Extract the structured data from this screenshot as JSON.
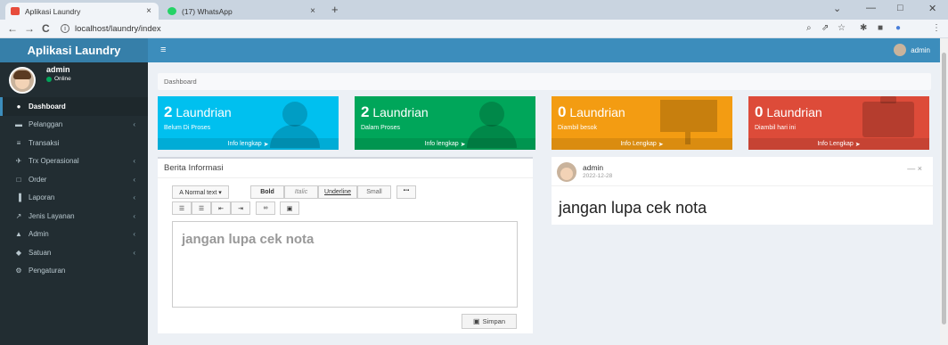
{
  "browser": {
    "tabs": [
      {
        "title": "Aplikasi Laundry",
        "close": "×"
      },
      {
        "title": "(17) WhatsApp",
        "close": "×"
      }
    ],
    "new_tab": "+",
    "url": "localhost/laundry/index",
    "info_glyph": "i",
    "back_glyph": "←",
    "forward_glyph": "→",
    "reload_glyph": "C",
    "window_controls": {
      "chevron": "⌄",
      "minimize": "—",
      "maximize": "□",
      "close": "✕"
    },
    "ext_icons": [
      "zoom-icon",
      "share-icon",
      "star-icon",
      "puzzle-icon",
      "sidepanel-icon",
      "profile-icon",
      "kebab-icon"
    ],
    "ext_glyphs": [
      "⌕",
      "⇗",
      "☆",
      "✱",
      "■",
      "●",
      "⋮"
    ],
    "favicon_colors": {
      "laundry": "#e74c3c",
      "whatsapp": "#25d366"
    }
  },
  "app": {
    "brand": "Aplikasi Laundry",
    "hamburger": "≡",
    "top_user": "admin"
  },
  "user": {
    "name": "admin",
    "status": "Online"
  },
  "menu": [
    {
      "label": "Dashboard",
      "icon": "dashboard-icon",
      "glyph": "●",
      "active": true,
      "has_children": false
    },
    {
      "label": "Pelanggan",
      "icon": "folder-icon",
      "glyph": "▬",
      "active": false,
      "has_children": true
    },
    {
      "label": "Transaksi",
      "icon": "cart-icon",
      "glyph": "≡",
      "active": false,
      "has_children": false
    },
    {
      "label": "Trx Operasional",
      "icon": "plane-icon",
      "glyph": "✈",
      "active": false,
      "has_children": true
    },
    {
      "label": "Order",
      "icon": "laptop-icon",
      "glyph": "□",
      "active": false,
      "has_children": true
    },
    {
      "label": "Laporan",
      "icon": "bar-chart-icon",
      "glyph": "▐",
      "active": false,
      "has_children": true
    },
    {
      "label": "Jenis Layanan",
      "icon": "pin-icon",
      "glyph": "↗",
      "active": false,
      "has_children": true
    },
    {
      "label": "Admin",
      "icon": "user-icon",
      "glyph": "▲",
      "active": false,
      "has_children": true
    },
    {
      "label": "Satuan",
      "icon": "tag-icon",
      "glyph": "◆",
      "active": false,
      "has_children": true
    },
    {
      "label": "Pengaturan",
      "icon": "gear-icon",
      "glyph": "⚙",
      "active": false,
      "has_children": false
    }
  ],
  "menu_chevron": "‹",
  "breadcrumb": "Dashboard",
  "info_boxes": [
    {
      "count": "2",
      "label": "Laundrian",
      "sub": "Belum Di Proses",
      "link": "Info lengkap",
      "color": "#00c0ef",
      "icon": "user-silhouette-icon"
    },
    {
      "count": "2",
      "label": "Laundrian",
      "sub": "Dalam Proses",
      "link": "Info lengkap",
      "color": "#00a65a",
      "icon": "user-silhouette-icon"
    },
    {
      "count": "0",
      "label": "Laundrian",
      "sub": "Diambil besok",
      "link": "Info Lengkap",
      "color": "#f39c12",
      "icon": "easel-icon"
    },
    {
      "count": "0",
      "label": "Laundrian",
      "sub": "Diambil hari ini",
      "link": "Info Lengkap",
      "color": "#dd4b39",
      "icon": "briefcase-icon"
    }
  ],
  "link_arrow": "➤",
  "berita": {
    "title": "Berita Informasi",
    "toolbar_row1": [
      "A Normal text ▾",
      "Bold",
      "Italic",
      "Underline",
      "Small",
      "““"
    ],
    "toolbar_row2": [
      "☰",
      "☰",
      "⇤",
      "⇥",
      "∞",
      "▣"
    ],
    "editor_text": "jangan lupa cek nota",
    "save_label": "Simpan"
  },
  "post": {
    "author": "admin",
    "date": "2022-12-28",
    "controls": "—  ×",
    "text": "jangan lupa cek nota"
  }
}
